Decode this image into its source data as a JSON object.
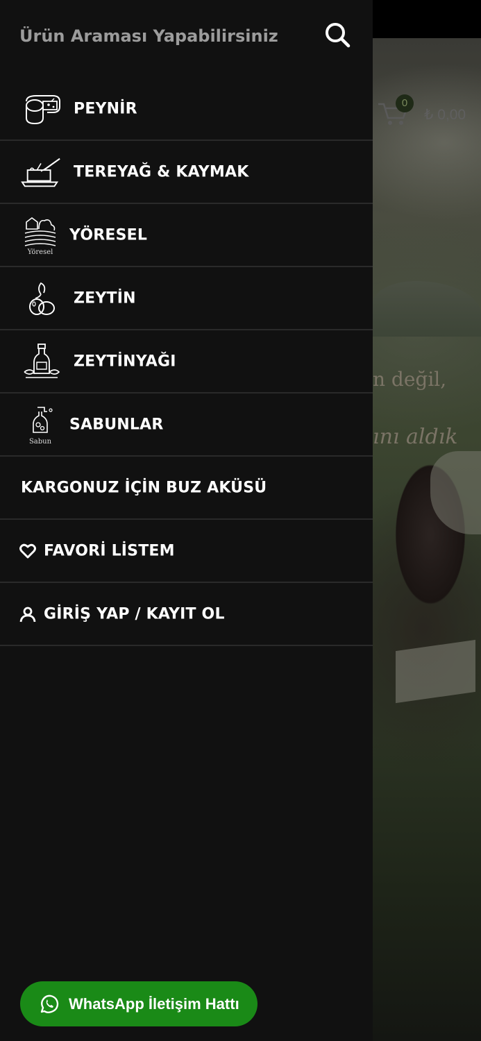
{
  "search": {
    "placeholder": "Ürün Araması Yapabilirsiniz"
  },
  "menu": {
    "items": [
      {
        "label": "PEYNİR",
        "icon": "cheese-icon"
      },
      {
        "label": "TEREYAĞ & KAYMAK",
        "icon": "butter-dish-icon"
      },
      {
        "label": "YÖRESEL",
        "icon": "regional-products-icon",
        "icon_caption": "Yöresel"
      },
      {
        "label": "ZEYTİN",
        "icon": "olive-icon"
      },
      {
        "label": "ZEYTİNYAĞI",
        "icon": "olive-oil-bottle-icon"
      },
      {
        "label": "SABUNLAR",
        "icon": "soap-bottle-icon",
        "icon_caption": "Sabun"
      },
      {
        "label": "KARGONUZ İÇİN BUZ AKÜSÜ"
      },
      {
        "label": "FAVORİ LİSTEM",
        "icon": "heart-icon"
      },
      {
        "label": "GİRİŞ YAP / KAYIT OL",
        "icon": "user-icon"
      }
    ]
  },
  "whatsapp": {
    "label": "WhatsApp İletişim Hattı",
    "icon": "whatsapp-icon",
    "color": "#1a8a17"
  },
  "background": {
    "cart_count": "0",
    "cart_total": "₺ 0,00",
    "hero_line1": "n değil,",
    "hero_line2": "ını aldık"
  },
  "colors": {
    "drawer_bg": "#111111",
    "divider": "#2a2a2a",
    "text": "#ffffff",
    "placeholder": "#9c9c9c"
  }
}
